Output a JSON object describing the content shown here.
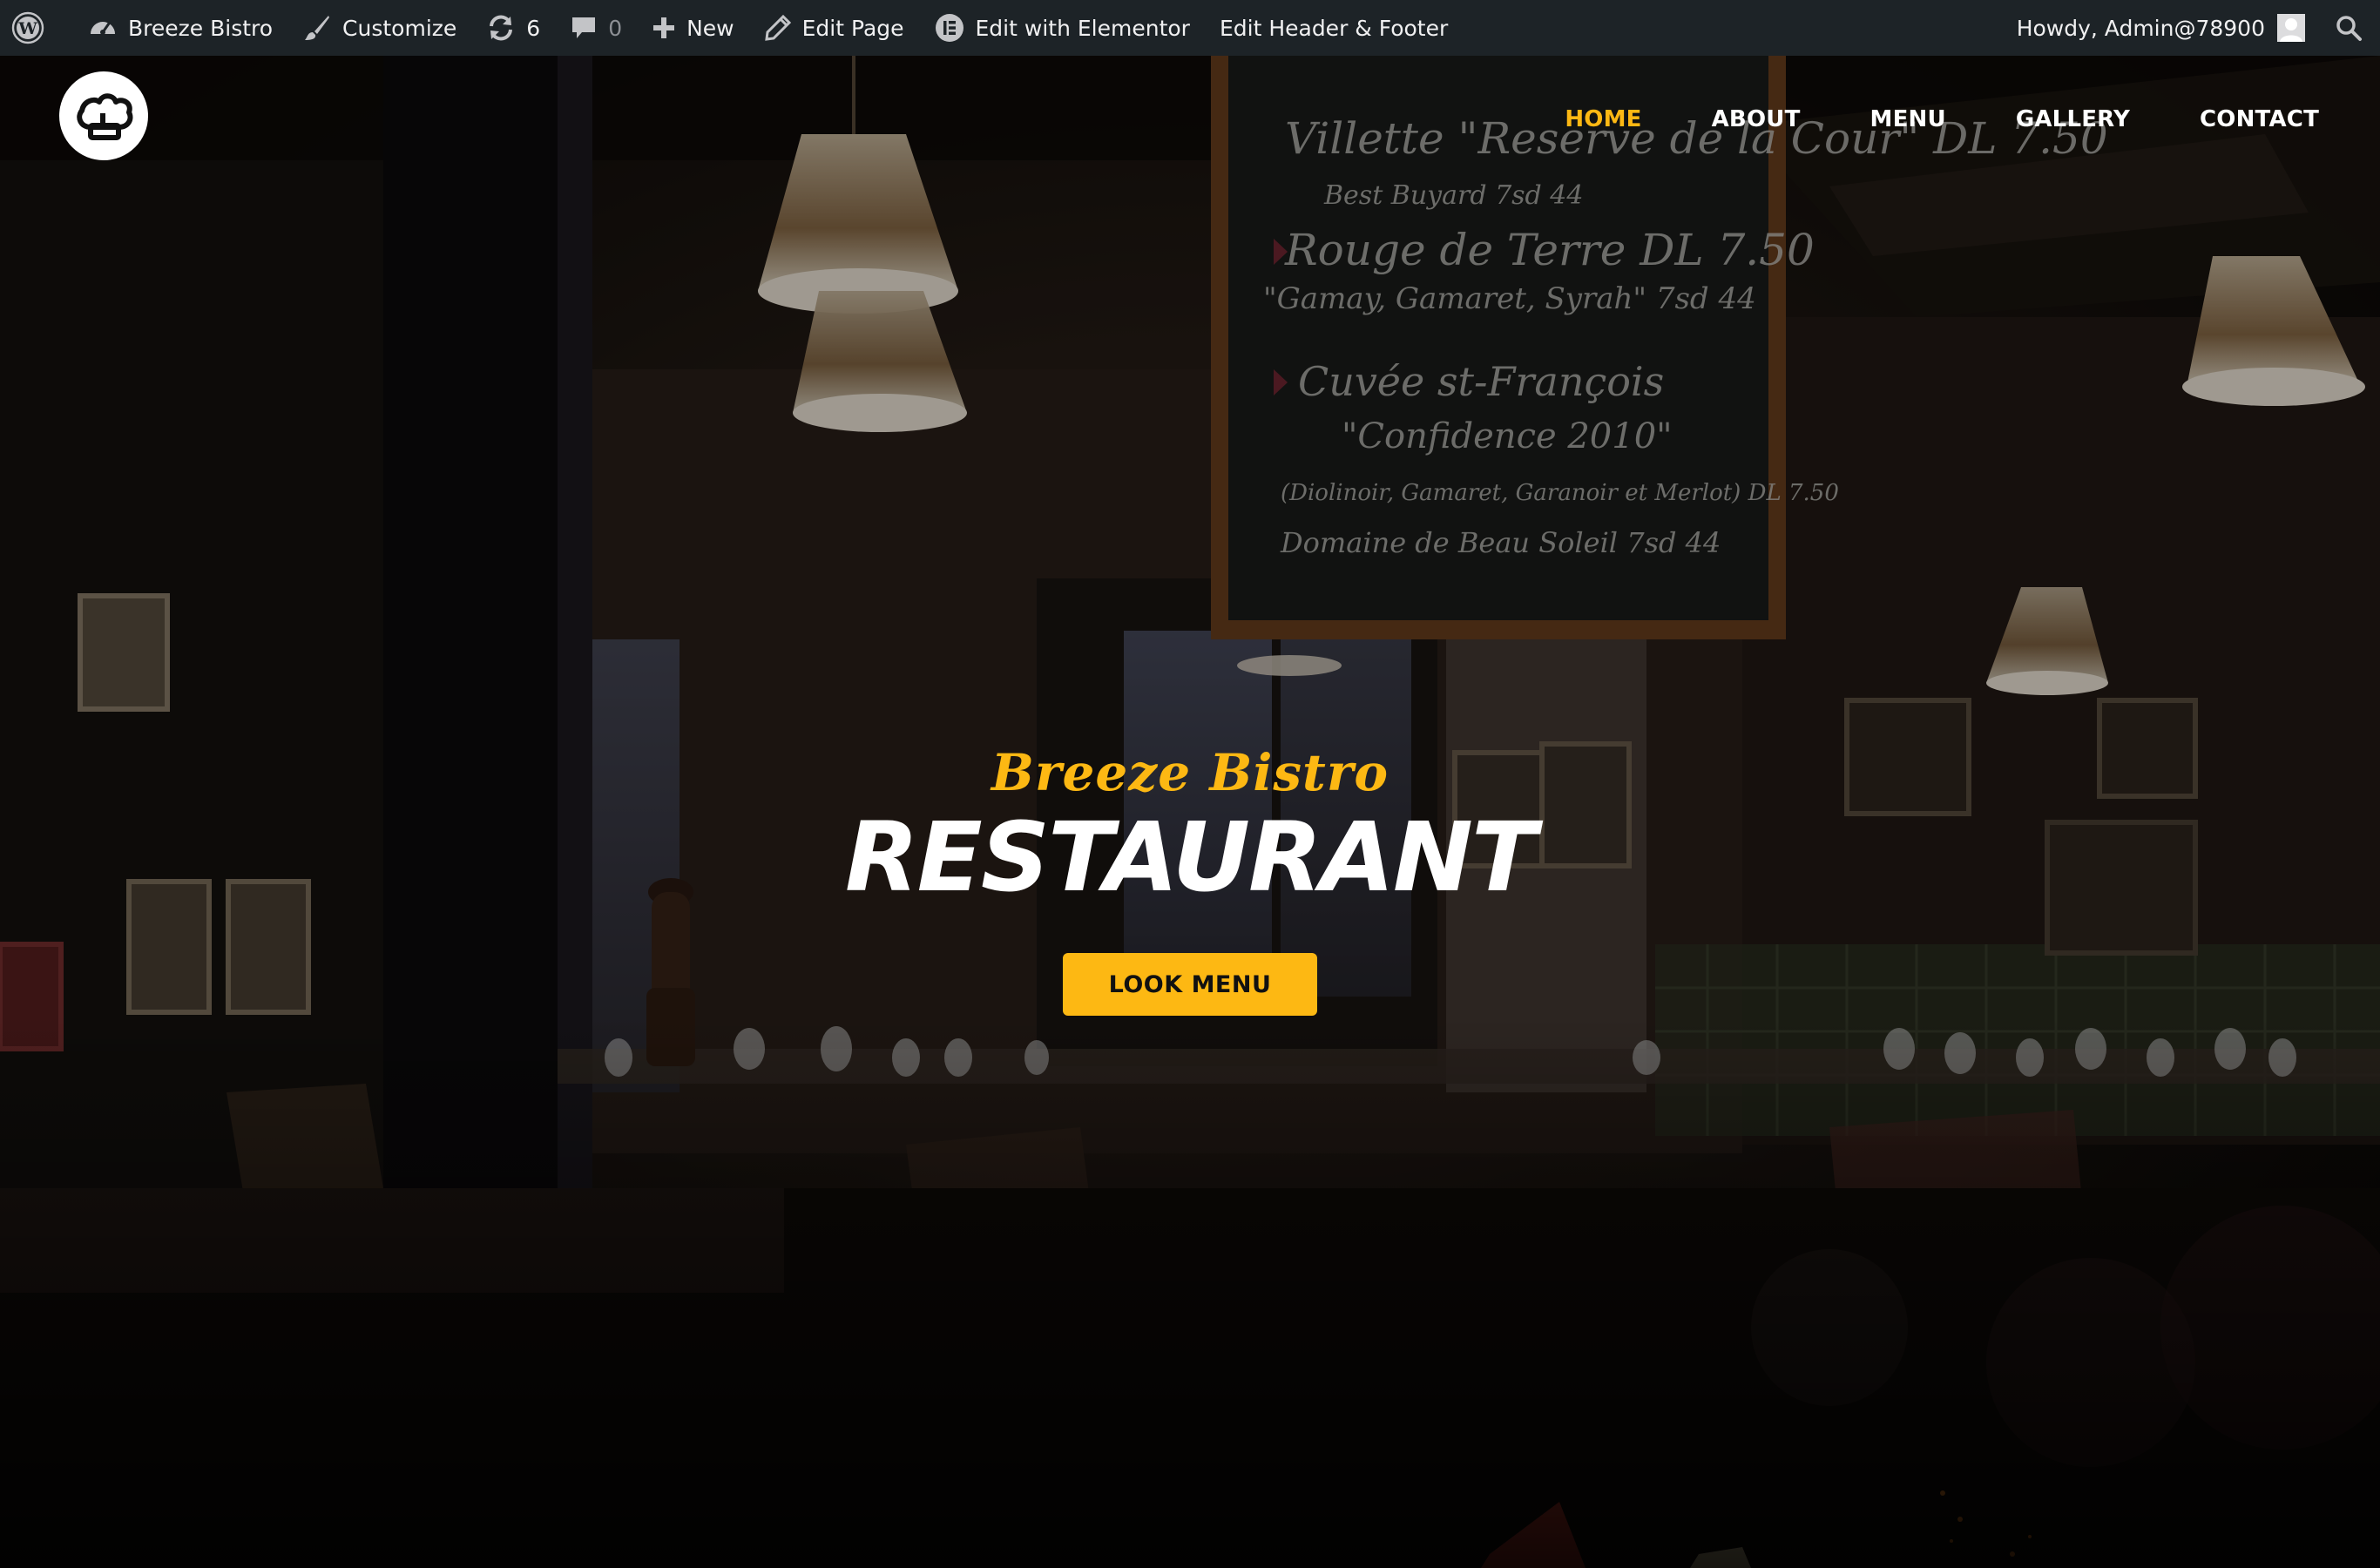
{
  "admin_bar": {
    "site_name": "Breeze Bistro",
    "customize": "Customize",
    "updates_count": "6",
    "comments_count": "0",
    "new": "New",
    "edit_page": "Edit Page",
    "edit_with_elementor": "Edit with Elementor",
    "edit_header_footer": "Edit Header & Footer",
    "greeting": "Howdy, Admin@78900",
    "icons": [
      "wordpress-icon",
      "dashboard-icon",
      "brush-icon",
      "refresh-icon",
      "comment-icon",
      "plus-icon",
      "pencil-icon",
      "elementor-icon",
      "avatar",
      "search-icon"
    ]
  },
  "header": {
    "logo_icon": "chef-hat-icon",
    "nav": [
      {
        "label": "HOME",
        "active": true
      },
      {
        "label": "ABOUT",
        "active": false
      },
      {
        "label": "MENU",
        "active": false
      },
      {
        "label": "GALLERY",
        "active": false
      },
      {
        "label": "CONTACT",
        "active": false
      }
    ]
  },
  "hero": {
    "tagline": "Breeze Bistro",
    "title": "RESTAURANT",
    "button_label": "LOOK MENU",
    "chalkboard": {
      "lines": [
        "Villette \"Reserve de la Cour\" DL 7.50",
        "Best Buyard 7sd 44",
        "Rouge de Terre DL 7.50",
        "\"Gamay, Gamaret, Syrah\" 7sd 44",
        "Cuvée st-François",
        "\"Confidence 2010\"",
        "(Diolinoir, Gamaret, Garanoir et Merlot) DL 7.50",
        "Domaine de Beau Soleil 7sd 44"
      ]
    }
  },
  "colors": {
    "accent": "#fdb813",
    "admin_bar_bg": "#1d2327",
    "text_light": "#ffffff"
  }
}
